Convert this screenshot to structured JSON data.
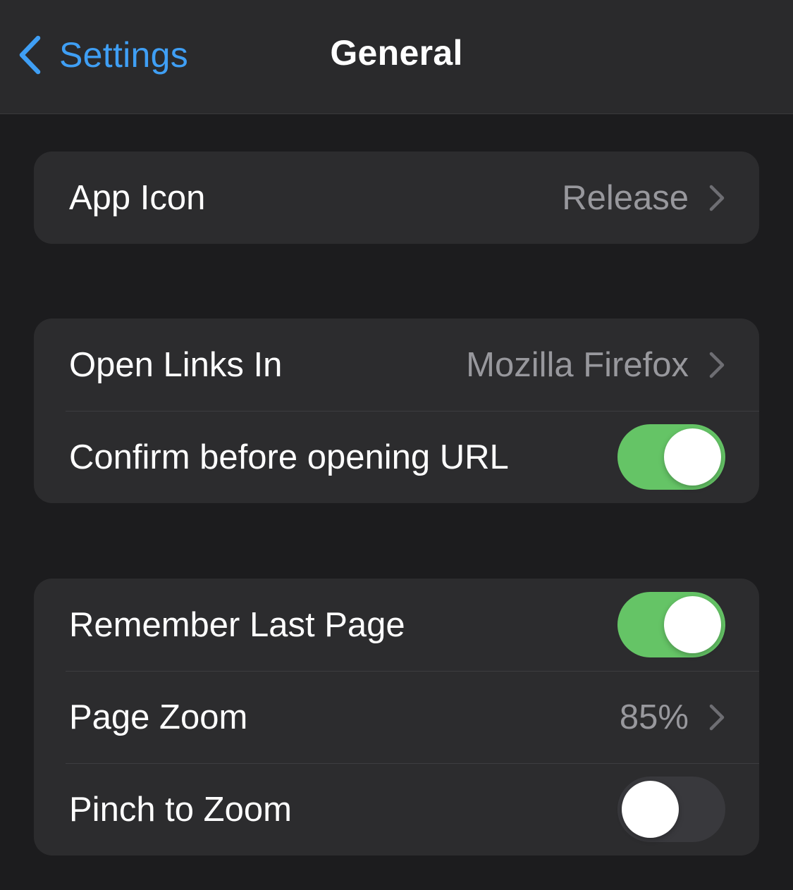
{
  "navbar": {
    "back_label": "Settings",
    "title": "General",
    "back_icon": "chevron-left-icon"
  },
  "groups": [
    {
      "rows": [
        {
          "label": "App Icon",
          "value": "Release",
          "type": "disclosure"
        }
      ]
    },
    {
      "rows": [
        {
          "label": "Open Links In",
          "value": "Mozilla Firefox",
          "type": "disclosure"
        },
        {
          "label": "Confirm before opening URL",
          "type": "toggle",
          "on": true
        }
      ]
    },
    {
      "rows": [
        {
          "label": "Remember Last Page",
          "type": "toggle",
          "on": true
        },
        {
          "label": "Page Zoom",
          "value": "85%",
          "type": "disclosure"
        },
        {
          "label": "Pinch to Zoom",
          "type": "toggle",
          "on": false
        }
      ]
    }
  ],
  "colors": {
    "accent": "#3f9ff5",
    "toggle_on": "#65c466",
    "toggle_off": "#39393d",
    "background": "#1c1c1e",
    "cell": "#2c2c2e",
    "secondary_text": "#98989d"
  }
}
